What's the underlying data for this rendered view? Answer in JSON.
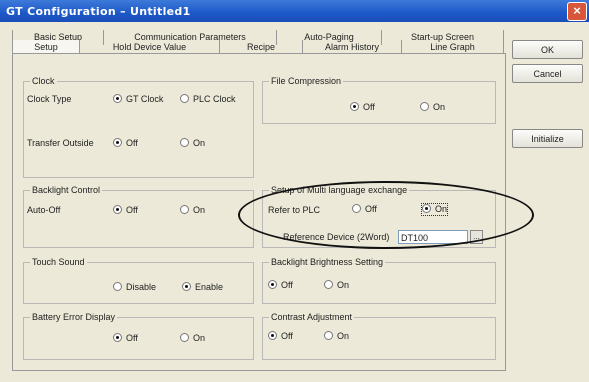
{
  "window": {
    "title": "GT Configuration  –  Untitled1",
    "close_glyph": "×"
  },
  "tabs_back": [
    "Basic Setup",
    "Communication Parameters",
    "Auto-Paging",
    "Start-up Screen"
  ],
  "tabs_front": [
    "Setup",
    "Hold Device Value",
    "Recipe",
    "Alarm History",
    "Line Graph"
  ],
  "buttons": {
    "ok": "OK",
    "cancel": "Cancel",
    "initialize": "Initialize"
  },
  "clock": {
    "legend": "Clock",
    "type_label": "Clock Type",
    "gt_clock": "GT Clock",
    "plc_clock": "PLC Clock",
    "transfer_label": "Transfer Outside",
    "off": "Off",
    "on": "On",
    "selected_type": "GT Clock",
    "selected_transfer": "Off"
  },
  "file_compression": {
    "legend": "File Compression",
    "off": "Off",
    "on": "On",
    "selected": "Off"
  },
  "backlight_control": {
    "legend": "Backlight Control",
    "auto_off_label": "Auto-Off",
    "off": "Off",
    "on": "On",
    "selected": "Off"
  },
  "multi_language": {
    "legend": "Setup of Multi language exchange",
    "refer_label": "Refer to PLC",
    "off": "Off",
    "on": "On",
    "selected": "On",
    "ref_device_label": "Reference Device (2Word)",
    "ref_device_value": "DT100",
    "browse_label": "..."
  },
  "touch_sound": {
    "legend": "Touch Sound",
    "disable": "Disable",
    "enable": "Enable",
    "selected": "Enable"
  },
  "backlight_brightness": {
    "legend": "Backlight Brightness Setting",
    "off": "Off",
    "on": "On",
    "selected": "Off"
  },
  "battery_error": {
    "legend": "Battery Error Display",
    "off": "Off",
    "on": "On",
    "selected": "Off"
  },
  "contrast": {
    "legend": "Contrast Adjustment",
    "off": "Off",
    "on": "On",
    "selected": "Off"
  }
}
